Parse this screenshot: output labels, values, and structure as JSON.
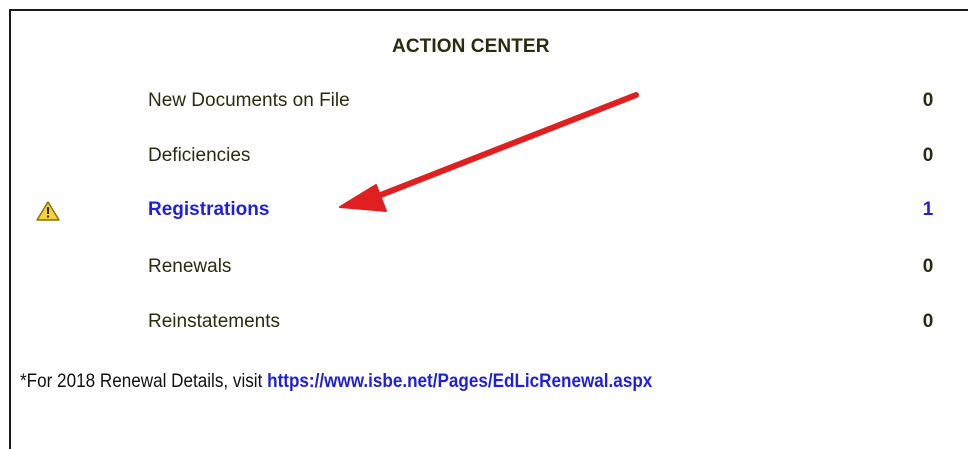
{
  "action_center": {
    "title": "ACTION CENTER",
    "rows": [
      {
        "label": "New Documents on File",
        "count": "0"
      },
      {
        "label": "Deficiencies",
        "count": "0"
      },
      {
        "label": "Registrations",
        "count": "1",
        "icon": "warning-icon"
      },
      {
        "label": "Renewals",
        "count": "0"
      },
      {
        "label": "Reinstatements",
        "count": "0"
      }
    ]
  },
  "footer": {
    "text": "*For 2018 Renewal Details, visit ",
    "link_text": "https://www.isbe.net/Pages/EdLicRenewal.aspx"
  },
  "colors": {
    "link": "#1f1fe0",
    "text": "#2b2b10",
    "annotation_arrow": "#e02020",
    "warning_fill": "#f5d33a"
  }
}
